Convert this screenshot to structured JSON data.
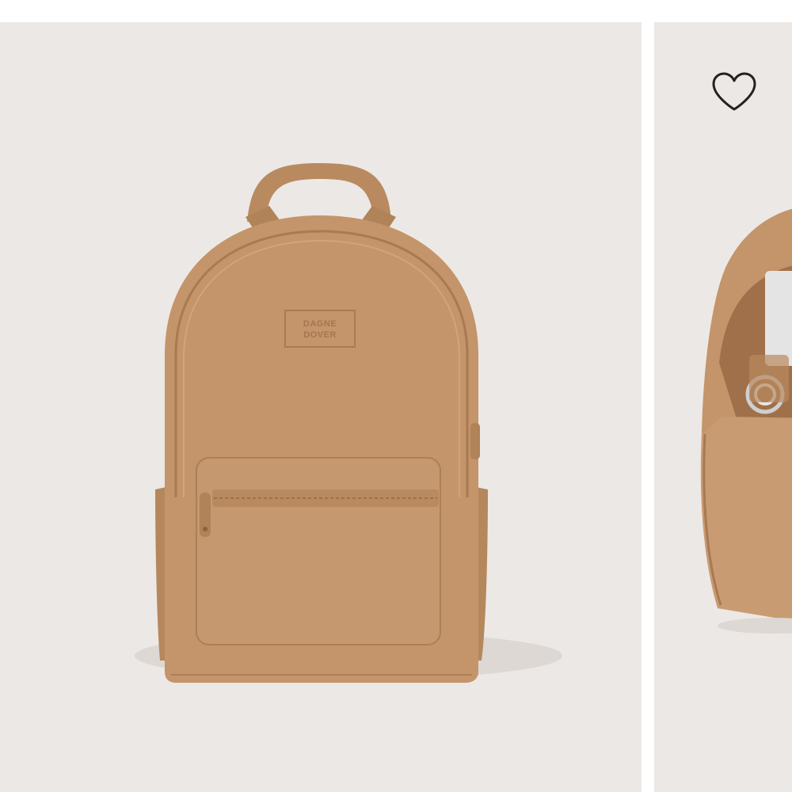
{
  "product": {
    "brand_patch": [
      "DAGNE",
      "DOVER"
    ]
  },
  "icons": {
    "wishlist": "heart-outline-icon"
  },
  "colors": {
    "background": "#ece8e5",
    "bag": "#c4946a",
    "bag_shadow": "#a97a52",
    "bag_highlight": "#d2a47a",
    "icon": "#222222"
  }
}
